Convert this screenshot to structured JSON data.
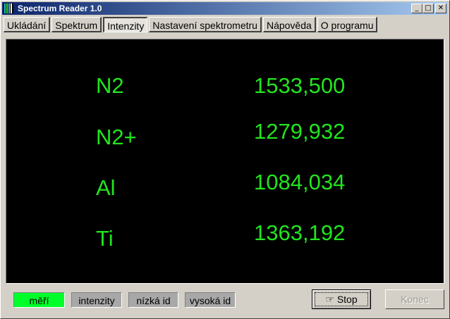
{
  "window": {
    "title": "Spectrum Reader 1.0",
    "controls": {
      "minimize": "_",
      "maximize": "□",
      "close": "✕"
    }
  },
  "tabs": [
    {
      "label": "Ukládání",
      "active": false
    },
    {
      "label": "Spektrum",
      "active": false
    },
    {
      "label": "Intenzity",
      "active": true
    },
    {
      "label": "Nastavení spektrometru",
      "active": false
    },
    {
      "label": "Nápověda",
      "active": false
    },
    {
      "label": "O programu",
      "active": false
    }
  ],
  "intensities": [
    {
      "element": "N2",
      "value": "1533,500"
    },
    {
      "element": "N2+",
      "value": "1279,932"
    },
    {
      "element": "Al",
      "value": "1084,034"
    },
    {
      "element": "Ti",
      "value": "1363,192"
    }
  ],
  "status": {
    "measuring": "měří",
    "intensities": "intenzity",
    "low_id": "nízká id",
    "high_id": "vysoká id"
  },
  "buttons": {
    "stop_icon": "☞",
    "stop": "Stop",
    "end": "Konec"
  },
  "colors": {
    "display_text": "#22e51e",
    "display_bg": "#000000",
    "indicator_active": "#00ff2a",
    "indicator_inactive": "#a8a8a8"
  }
}
